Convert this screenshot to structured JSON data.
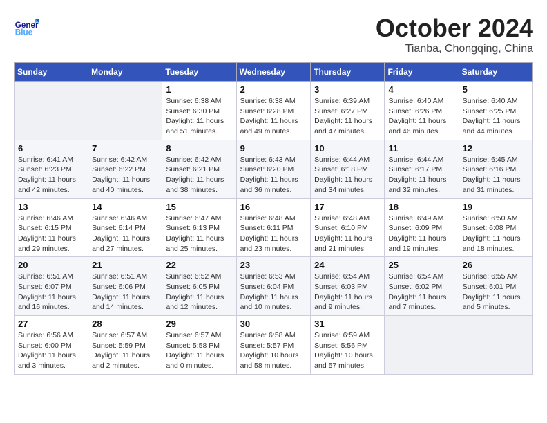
{
  "header": {
    "logo_general": "General",
    "logo_blue": "Blue",
    "month_title": "October 2024",
    "location": "Tianba, Chongqing, China"
  },
  "weekdays": [
    "Sunday",
    "Monday",
    "Tuesday",
    "Wednesday",
    "Thursday",
    "Friday",
    "Saturday"
  ],
  "weeks": [
    [
      {
        "day": "",
        "info": ""
      },
      {
        "day": "",
        "info": ""
      },
      {
        "day": "1",
        "info": "Sunrise: 6:38 AM\nSunset: 6:30 PM\nDaylight: 11 hours and 51 minutes."
      },
      {
        "day": "2",
        "info": "Sunrise: 6:38 AM\nSunset: 6:28 PM\nDaylight: 11 hours and 49 minutes."
      },
      {
        "day": "3",
        "info": "Sunrise: 6:39 AM\nSunset: 6:27 PM\nDaylight: 11 hours and 47 minutes."
      },
      {
        "day": "4",
        "info": "Sunrise: 6:40 AM\nSunset: 6:26 PM\nDaylight: 11 hours and 46 minutes."
      },
      {
        "day": "5",
        "info": "Sunrise: 6:40 AM\nSunset: 6:25 PM\nDaylight: 11 hours and 44 minutes."
      }
    ],
    [
      {
        "day": "6",
        "info": "Sunrise: 6:41 AM\nSunset: 6:23 PM\nDaylight: 11 hours and 42 minutes."
      },
      {
        "day": "7",
        "info": "Sunrise: 6:42 AM\nSunset: 6:22 PM\nDaylight: 11 hours and 40 minutes."
      },
      {
        "day": "8",
        "info": "Sunrise: 6:42 AM\nSunset: 6:21 PM\nDaylight: 11 hours and 38 minutes."
      },
      {
        "day": "9",
        "info": "Sunrise: 6:43 AM\nSunset: 6:20 PM\nDaylight: 11 hours and 36 minutes."
      },
      {
        "day": "10",
        "info": "Sunrise: 6:44 AM\nSunset: 6:18 PM\nDaylight: 11 hours and 34 minutes."
      },
      {
        "day": "11",
        "info": "Sunrise: 6:44 AM\nSunset: 6:17 PM\nDaylight: 11 hours and 32 minutes."
      },
      {
        "day": "12",
        "info": "Sunrise: 6:45 AM\nSunset: 6:16 PM\nDaylight: 11 hours and 31 minutes."
      }
    ],
    [
      {
        "day": "13",
        "info": "Sunrise: 6:46 AM\nSunset: 6:15 PM\nDaylight: 11 hours and 29 minutes."
      },
      {
        "day": "14",
        "info": "Sunrise: 6:46 AM\nSunset: 6:14 PM\nDaylight: 11 hours and 27 minutes."
      },
      {
        "day": "15",
        "info": "Sunrise: 6:47 AM\nSunset: 6:13 PM\nDaylight: 11 hours and 25 minutes."
      },
      {
        "day": "16",
        "info": "Sunrise: 6:48 AM\nSunset: 6:11 PM\nDaylight: 11 hours and 23 minutes."
      },
      {
        "day": "17",
        "info": "Sunrise: 6:48 AM\nSunset: 6:10 PM\nDaylight: 11 hours and 21 minutes."
      },
      {
        "day": "18",
        "info": "Sunrise: 6:49 AM\nSunset: 6:09 PM\nDaylight: 11 hours and 19 minutes."
      },
      {
        "day": "19",
        "info": "Sunrise: 6:50 AM\nSunset: 6:08 PM\nDaylight: 11 hours and 18 minutes."
      }
    ],
    [
      {
        "day": "20",
        "info": "Sunrise: 6:51 AM\nSunset: 6:07 PM\nDaylight: 11 hours and 16 minutes."
      },
      {
        "day": "21",
        "info": "Sunrise: 6:51 AM\nSunset: 6:06 PM\nDaylight: 11 hours and 14 minutes."
      },
      {
        "day": "22",
        "info": "Sunrise: 6:52 AM\nSunset: 6:05 PM\nDaylight: 11 hours and 12 minutes."
      },
      {
        "day": "23",
        "info": "Sunrise: 6:53 AM\nSunset: 6:04 PM\nDaylight: 11 hours and 10 minutes."
      },
      {
        "day": "24",
        "info": "Sunrise: 6:54 AM\nSunset: 6:03 PM\nDaylight: 11 hours and 9 minutes."
      },
      {
        "day": "25",
        "info": "Sunrise: 6:54 AM\nSunset: 6:02 PM\nDaylight: 11 hours and 7 minutes."
      },
      {
        "day": "26",
        "info": "Sunrise: 6:55 AM\nSunset: 6:01 PM\nDaylight: 11 hours and 5 minutes."
      }
    ],
    [
      {
        "day": "27",
        "info": "Sunrise: 6:56 AM\nSunset: 6:00 PM\nDaylight: 11 hours and 3 minutes."
      },
      {
        "day": "28",
        "info": "Sunrise: 6:57 AM\nSunset: 5:59 PM\nDaylight: 11 hours and 2 minutes."
      },
      {
        "day": "29",
        "info": "Sunrise: 6:57 AM\nSunset: 5:58 PM\nDaylight: 11 hours and 0 minutes."
      },
      {
        "day": "30",
        "info": "Sunrise: 6:58 AM\nSunset: 5:57 PM\nDaylight: 10 hours and 58 minutes."
      },
      {
        "day": "31",
        "info": "Sunrise: 6:59 AM\nSunset: 5:56 PM\nDaylight: 10 hours and 57 minutes."
      },
      {
        "day": "",
        "info": ""
      },
      {
        "day": "",
        "info": ""
      }
    ]
  ]
}
